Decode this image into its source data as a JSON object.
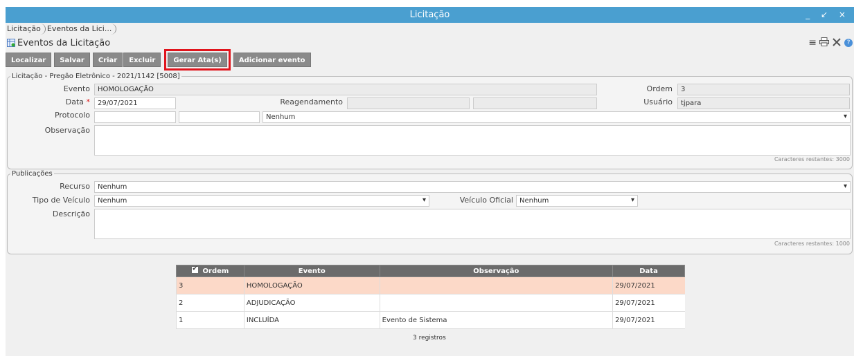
{
  "window": {
    "title": "Licitação",
    "controls": "_ ↙ ×"
  },
  "breadcrumb": [
    "Licitação",
    "Eventos da Lici..."
  ],
  "page_title": "Eventos da Licitação",
  "toolbar": {
    "localizar": "Localizar",
    "salvar": "Salvar",
    "criar": "Criar",
    "excluir": "Excluir",
    "gerar_atas": "Gerar Ata(s)",
    "adicionar_evento": "Adicionar evento"
  },
  "licitacao": {
    "legend": "Licitação - Pregão Eletrônico - 2021/1142 [5008]",
    "evento_label": "Evento",
    "evento_value": "HOMOLOGAÇÃO",
    "ordem_label": "Ordem",
    "ordem_value": "3",
    "data_label": "Data",
    "data_required": "*",
    "data_value": "29/07/2021",
    "reagendamento_label": "Reagendamento",
    "usuario_label": "Usuário",
    "usuario_value": "tjpara",
    "protocolo_label": "Protocolo",
    "protocolo_select": "Nenhum",
    "observacao_label": "Observação",
    "observacao_counter": "Caracteres restantes: 3000"
  },
  "publicacoes": {
    "legend": "Publicações",
    "recurso_label": "Recurso",
    "recurso_value": "Nenhum",
    "tipo_veiculo_label": "Tipo de Veículo",
    "tipo_veiculo_value": "Nenhum",
    "veiculo_oficial_label": "Veículo Oficial",
    "veiculo_oficial_value": "Nenhum",
    "descricao_label": "Descrição",
    "descricao_counter": "Caracteres restantes: 1000"
  },
  "table": {
    "headers": [
      "Ordem",
      "Evento",
      "Observação",
      "Data"
    ],
    "rows": [
      {
        "ordem": "3",
        "evento": "HOMOLOGAÇÃO",
        "observacao": "",
        "data": "29/07/2021"
      },
      {
        "ordem": "2",
        "evento": "ADJUDICAÇÃO",
        "observacao": "",
        "data": "29/07/2021"
      },
      {
        "ordem": "1",
        "evento": "INCLUÍDA",
        "observacao": "Evento de Sistema",
        "data": "29/07/2021"
      }
    ],
    "record_count": "3 registros"
  },
  "colors": {
    "title_bar": "#4a9fd0",
    "toolbar_button": "#8a8a8a",
    "highlight_box": "#e0141c",
    "selected_row": "#fcd9c8"
  }
}
